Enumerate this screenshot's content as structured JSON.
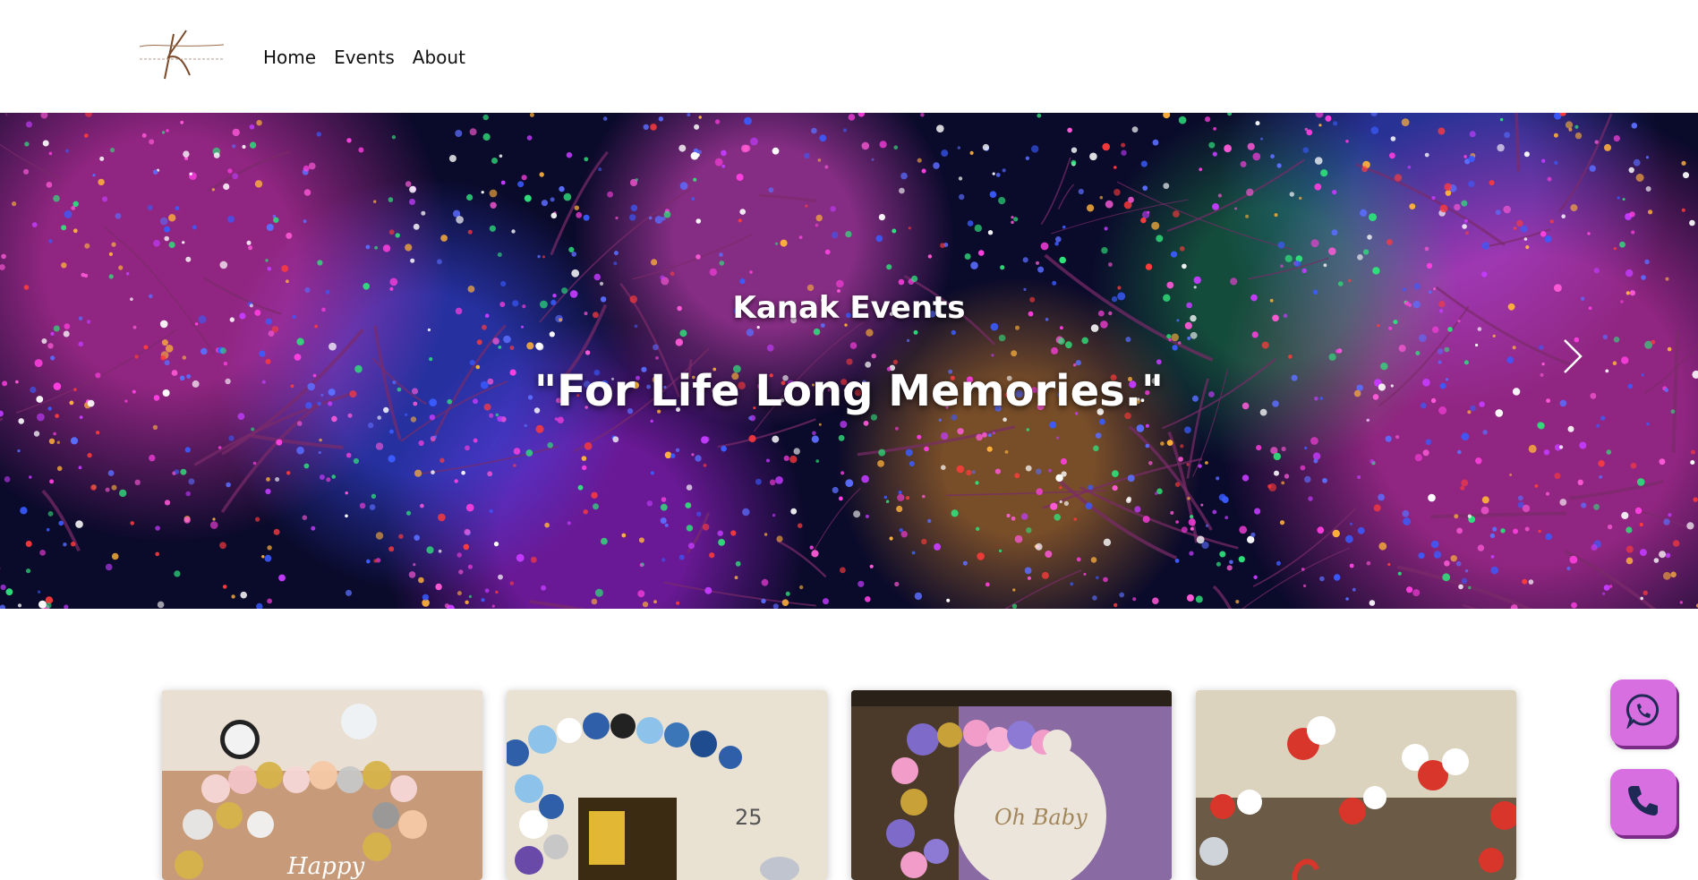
{
  "header": {
    "logo": {
      "name": "logo-kanak-events",
      "alt_text": "Kanak events-life For Life Long Memories"
    },
    "nav": [
      {
        "label": "Home"
      },
      {
        "label": "Events"
      },
      {
        "label": "About"
      }
    ]
  },
  "hero": {
    "title": "Kanak Events",
    "tagline": "\"For Life Long Memories.\"",
    "next_icon": "chevron-right-icon"
  },
  "cards": [
    {
      "name": "event-card-happy-birthday",
      "caption": "Happy"
    },
    {
      "name": "event-card-anniversary-25",
      "caption": "25"
    },
    {
      "name": "event-card-oh-baby",
      "caption": "Oh Baby"
    },
    {
      "name": "event-card-love-decor",
      "caption": ""
    }
  ],
  "floating": {
    "whatsapp_icon": "whatsapp-icon",
    "call_icon": "phone-icon",
    "accent_color": "#d86fe0"
  }
}
